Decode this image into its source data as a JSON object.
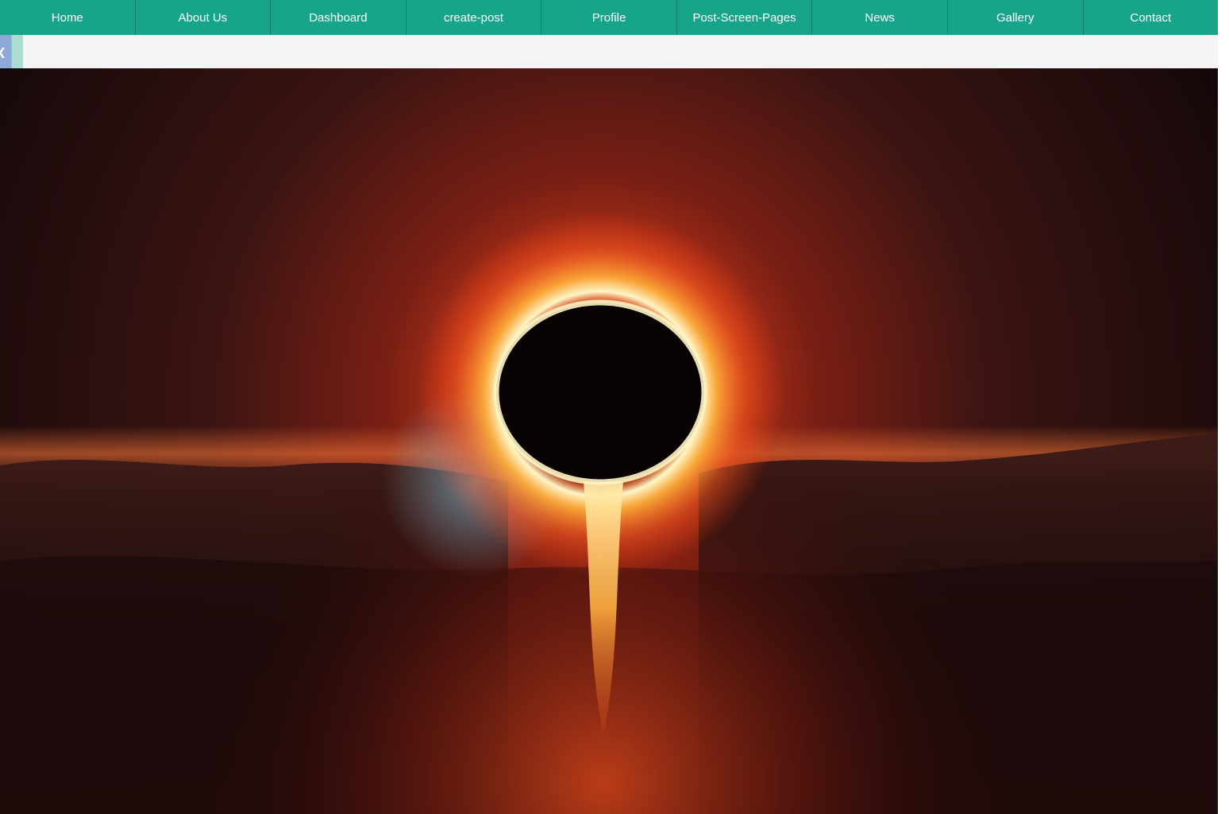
{
  "nav": {
    "items": [
      {
        "label": "Home"
      },
      {
        "label": "About Us"
      },
      {
        "label": "Dashboard"
      },
      {
        "label": "create-post"
      },
      {
        "label": "Profile"
      },
      {
        "label": "Post-Screen-Pages"
      },
      {
        "label": "News"
      },
      {
        "label": "Gallery"
      },
      {
        "label": "Contact"
      }
    ]
  },
  "colors": {
    "nav_background": "#17a589",
    "nav_text": "#ffffff",
    "subbar_background": "#f4f4f4"
  },
  "icons": {
    "sidebar_toggle": "chevron-left-icon"
  }
}
